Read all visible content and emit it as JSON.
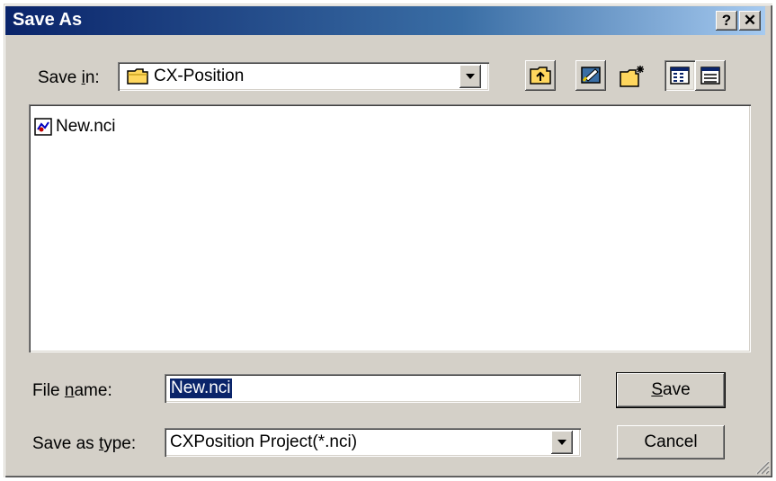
{
  "window": {
    "title": "Save As",
    "help_label": "?",
    "close_label": "✕"
  },
  "toolbar": {
    "save_in_label_pre": "Save ",
    "save_in_label_key": "i",
    "save_in_label_post": "n:",
    "save_in_value": "CX-Position",
    "up_folder_icon": "up-folder-icon",
    "desktop_icon": "desktop-icon",
    "new_folder_icon": "new-folder-icon",
    "list_view_icon": "list-view-icon",
    "details_view_icon": "details-view-icon"
  },
  "files": [
    {
      "name": "New.nci",
      "icon": "nci-file-icon"
    }
  ],
  "form": {
    "file_name_label_pre": "File ",
    "file_name_label_key": "n",
    "file_name_label_post": "ame:",
    "file_name_value": "New.nci",
    "save_as_type_label_pre": "Save as ",
    "save_as_type_label_key": "t",
    "save_as_type_label_post": "ype:",
    "save_as_type_value": "CXPosition Project(*.nci)"
  },
  "buttons": {
    "save_key": "S",
    "save_rest": "ave",
    "cancel_label": "Cancel"
  },
  "colors": {
    "titlebar_start": "#0a246a",
    "titlebar_end": "#a6caf0",
    "face": "#d4d0c8",
    "selection": "#0a246a"
  }
}
